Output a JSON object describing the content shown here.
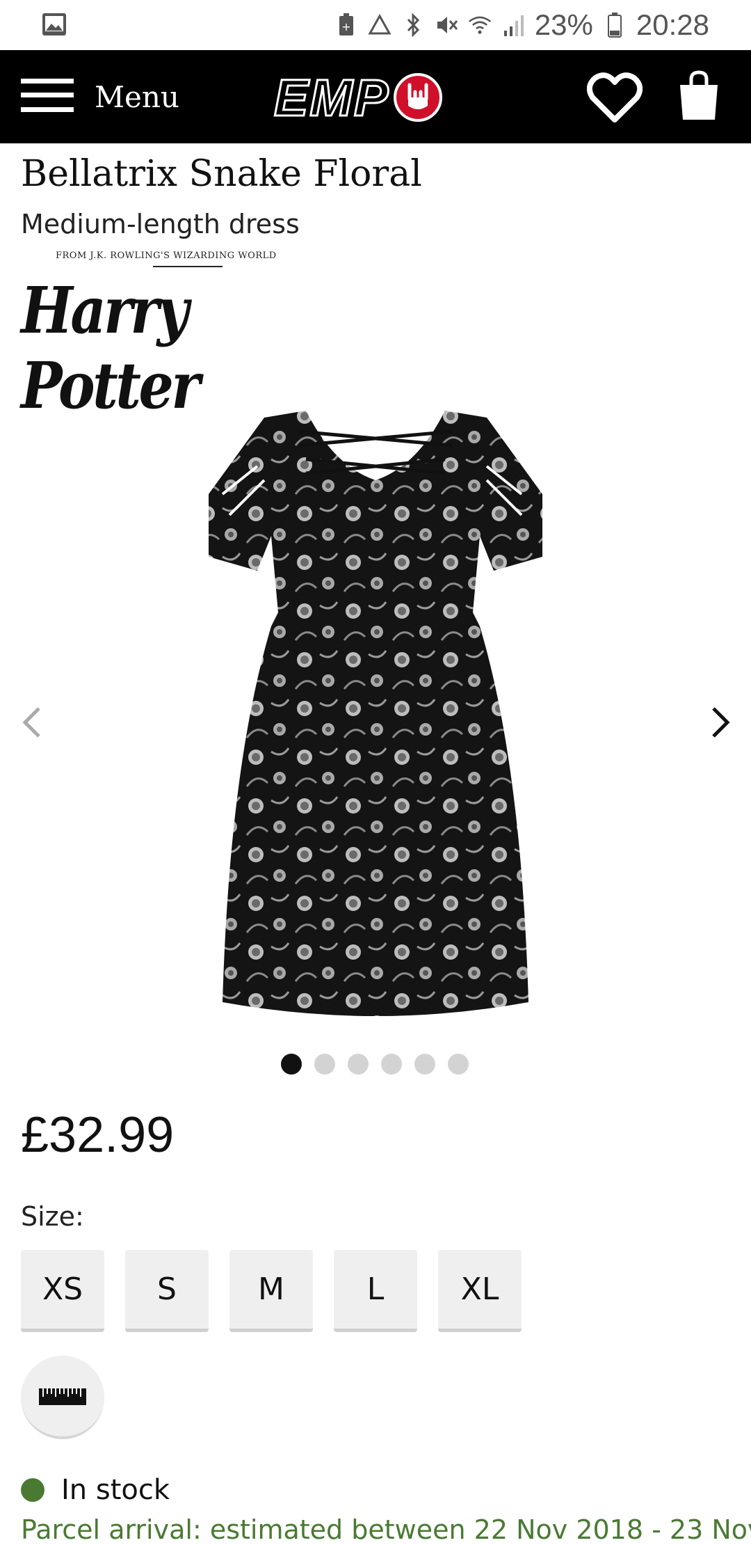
{
  "status_bar": {
    "battery_percent": "23%",
    "time": "20:28",
    "icons": [
      "image-icon",
      "battery-saver-icon",
      "recycle-icon",
      "bluetooth-icon",
      "mute-icon",
      "wifi-icon",
      "signal-icon",
      "battery-icon"
    ]
  },
  "header": {
    "menu_label": "Menu",
    "logo_text": "EMP",
    "icons": [
      "hamburger-icon",
      "heart-icon",
      "shopping-bag-icon"
    ]
  },
  "product": {
    "title": "Bellatrix Snake Floral",
    "subtitle": "Medium-length dress",
    "brand_tagline": "FROM J.K. ROWLING'S WIZARDING WORLD",
    "brand_name": "Harry Potter",
    "gallery_dot_count": 6,
    "active_dot_index": 0,
    "price": "£32.99",
    "size_label": "Size:",
    "sizes": [
      "XS",
      "S",
      "M",
      "L",
      "XL"
    ],
    "stock_status": "In stock",
    "stock_color": "#4a7a32",
    "arrival_text": "Parcel arrival: estimated between 22 Nov 2018 - 23 Nov"
  },
  "colors": {
    "header_bg": "#000000",
    "logo_badge": "#d0102a",
    "size_button_bg": "#efefef",
    "stock_green": "#4a7a32"
  }
}
